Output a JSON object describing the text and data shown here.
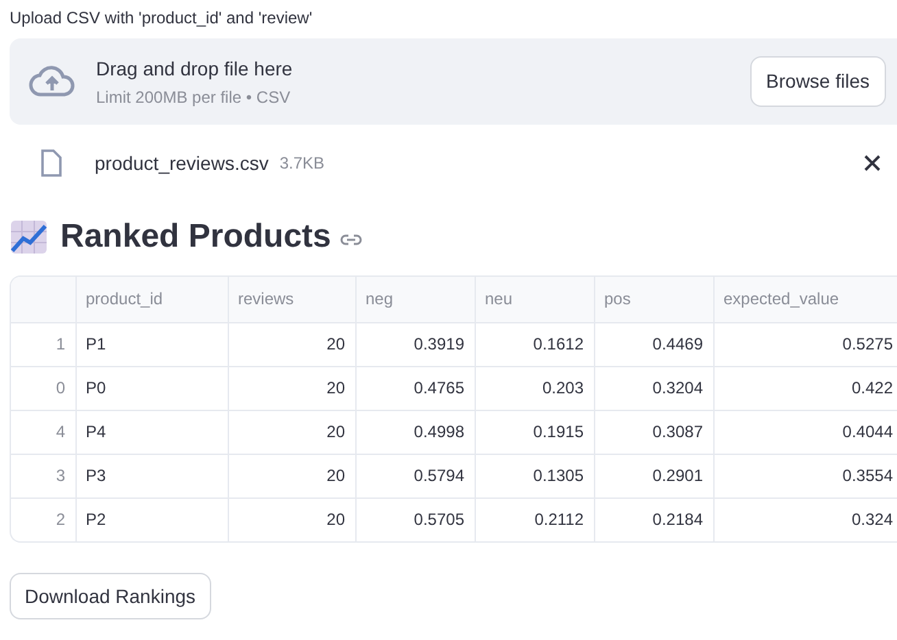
{
  "uploader": {
    "label": "Upload CSV with 'product_id' and 'review'",
    "drop_text": "Drag and drop file here",
    "limit_text": "Limit 200MB per file • CSV",
    "browse_button": "Browse files"
  },
  "file": {
    "name": "product_reviews.csv",
    "size": "3.7KB"
  },
  "heading": "Ranked Products",
  "table": {
    "columns": [
      "",
      "product_id",
      "reviews",
      "neg",
      "neu",
      "pos",
      "expected_value"
    ],
    "rows": [
      [
        "1",
        "P1",
        "20",
        "0.3919",
        "0.1612",
        "0.4469",
        "0.5275"
      ],
      [
        "0",
        "P0",
        "20",
        "0.4765",
        "0.203",
        "0.3204",
        "0.422"
      ],
      [
        "4",
        "P4",
        "20",
        "0.4998",
        "0.1915",
        "0.3087",
        "0.4044"
      ],
      [
        "3",
        "P3",
        "20",
        "0.5794",
        "0.1305",
        "0.2901",
        "0.3554"
      ],
      [
        "2",
        "P2",
        "20",
        "0.5705",
        "0.2112",
        "0.2184",
        "0.324"
      ]
    ]
  },
  "download_button": "Download Rankings"
}
